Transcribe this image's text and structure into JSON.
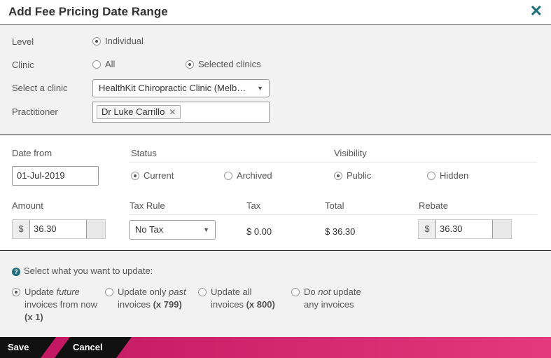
{
  "dialog": {
    "title": "Add Fee Pricing Date Range",
    "close_glyph": "✕"
  },
  "level": {
    "label": "Level",
    "options": [
      {
        "label": "Individual",
        "selected": true
      }
    ]
  },
  "clinic": {
    "label": "Clinic",
    "options": [
      {
        "label": "All",
        "selected": false
      },
      {
        "label": "Selected clinics",
        "selected": true
      }
    ]
  },
  "select_clinic": {
    "label": "Select a clinic",
    "value": "HealthKit Chiropractic Clinic (Melb…"
  },
  "practitioner": {
    "label": "Practitioner",
    "tags": [
      "Dr Luke Carrillo"
    ],
    "remove_glyph": "✕"
  },
  "date_from": {
    "label": "Date from",
    "value": "01-Jul-2019"
  },
  "status": {
    "label": "Status",
    "options": [
      {
        "label": "Current",
        "selected": true
      },
      {
        "label": "Archived",
        "selected": false
      }
    ]
  },
  "visibility": {
    "label": "Visibility",
    "options": [
      {
        "label": "Public",
        "selected": true
      },
      {
        "label": "Hidden",
        "selected": false
      }
    ]
  },
  "amount": {
    "label": "Amount",
    "currency": "$",
    "value": "36.30"
  },
  "tax_rule": {
    "label": "Tax Rule",
    "value": "No Tax"
  },
  "tax": {
    "label": "Tax",
    "value": "$ 0.00"
  },
  "total": {
    "label": "Total",
    "value": "$ 36.30"
  },
  "rebate": {
    "label": "Rebate",
    "currency": "$",
    "value": "36.30"
  },
  "update": {
    "prompt": "Select what you want to update:",
    "options": [
      {
        "pre": "Update ",
        "em": "future",
        "post": " invoices from now",
        "count": "(x 1)",
        "selected": true
      },
      {
        "pre": "Update only ",
        "em": "past",
        "post": " invoices ",
        "count": "(x 799)",
        "selected": false
      },
      {
        "pre": "Update all invoices ",
        "em": "",
        "post": "",
        "count": "(x 800)",
        "selected": false
      },
      {
        "pre": "Do ",
        "em": "not",
        "post": " update any invoices",
        "count": "",
        "selected": false
      }
    ]
  },
  "footer": {
    "save_label": "Save",
    "cancel_label": "Cancel"
  },
  "colors": {
    "accent": "#1e6e7d",
    "footer_pink": "#d81b66"
  }
}
